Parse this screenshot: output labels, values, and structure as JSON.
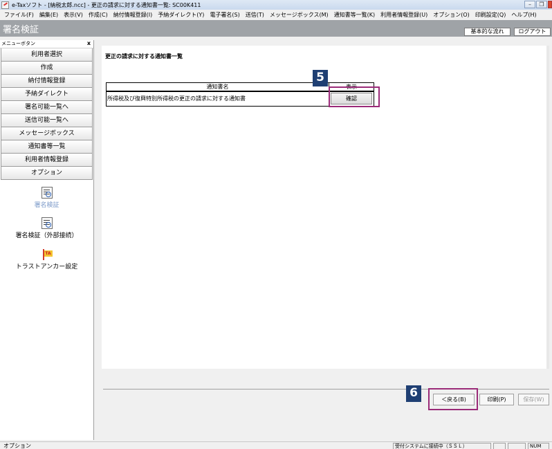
{
  "window": {
    "title": "e-Taxソフト - [納税太郎.ncc] - 更正の請求に対する通知書一覧: SC00K411",
    "min_symbol": "–",
    "restore_symbol": "❐"
  },
  "menu": [
    "ファイル(F)",
    "編集(E)",
    "表示(V)",
    "作成(C)",
    "納付情報登録(I)",
    "予納ダイレクト(Y)",
    "電子署名(S)",
    "送信(T)",
    "メッセージボックス(M)",
    "通知書等一覧(K)",
    "利用者情報登録(U)",
    "オプション(O)",
    "印刷設定(Q)",
    "ヘルプ(H)"
  ],
  "band": {
    "title": "署名検証",
    "flow_button": "基本的な流れ",
    "logout_button": "ログアウト"
  },
  "sidebar": {
    "header": "メニューボタン",
    "close_label": "x",
    "nav": [
      "利用者選択",
      "作成",
      "納付情報登録",
      "予納ダイレクト",
      "署名可能一覧へ",
      "送信可能一覧へ",
      "メッセージボックス",
      "通知書等一覧",
      "利用者情報登録",
      "オプション"
    ],
    "tools": [
      {
        "label": "署名検証",
        "selected": true
      },
      {
        "label": "署名検証（外部接続）",
        "selected": false
      },
      {
        "label": "トラストアンカー設定",
        "selected": false
      }
    ],
    "ta_flag": "TA"
  },
  "main": {
    "title": "更正の請求に対する通知書一覧",
    "table": {
      "headers": [
        "通知書名",
        "表示"
      ],
      "rows": [
        {
          "name": "所得税及び復興特別所得税の更正の請求に対する通知書",
          "action": "確認"
        }
      ]
    }
  },
  "actions": {
    "back": "＜戻る(B)",
    "print": "印刷(P)",
    "save": "保存(W)"
  },
  "callouts": [
    "5",
    "6"
  ],
  "status": {
    "left": "オプション",
    "connection": "受付システムに接続中（ＳＳＬ）",
    "num": "NUM"
  },
  "colors": {
    "band": "#9fa3a7",
    "callout_border": "#9a2a78",
    "callout_badge": "#1f3f73"
  }
}
